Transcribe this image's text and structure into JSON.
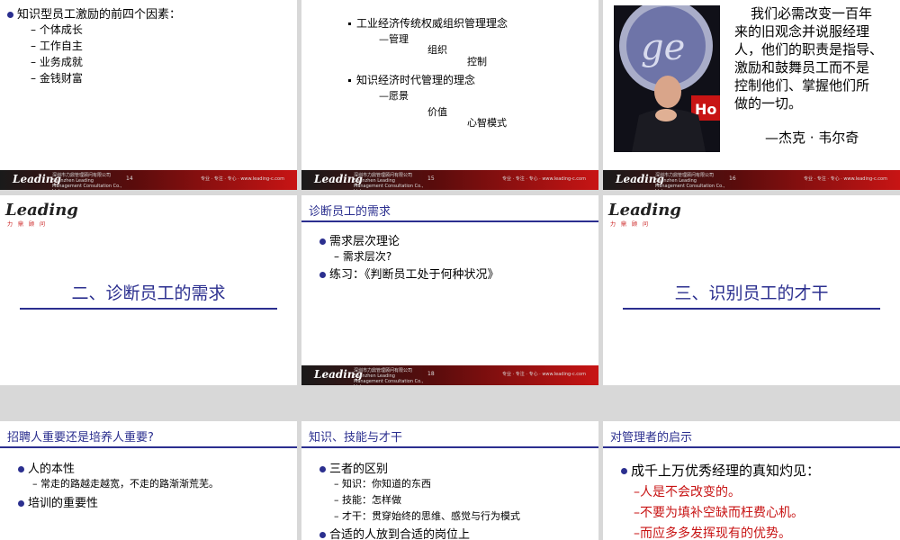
{
  "footer": {
    "logo": "Leading",
    "company": "深圳市力鼎管理顾问有限公司",
    "company_en": "Shenzhen Leading Management Consultation Co., Ltd.",
    "url": "专业 · 专注 · 专心 · www.leading-c.com"
  },
  "slide14": {
    "heading": "知识型员工激励的前四个因素：",
    "items": [
      "个体成长",
      "工作自主",
      "业务成就",
      "金钱财富"
    ],
    "page": "14"
  },
  "slide15": {
    "b1": "工业经济传统权威组织管理理念",
    "b1_sub": [
      "—管理",
      "组织",
      "控制"
    ],
    "b2": "知识经济时代管理的理念",
    "b2_sub": [
      "—愿景",
      "价值",
      "心智模式"
    ],
    "page": "15"
  },
  "slide16": {
    "quote": [
      "我们必需改变一百年",
      "来的旧观念并说服经理",
      "人，他们的职责是指导、",
      "激励和鼓舞员工而不是",
      "控制他们、掌握他们所",
      "做的一切。"
    ],
    "author": "—杰克 · 韦尔奇",
    "page": "16"
  },
  "slide17": {
    "logo": "Leading",
    "logo_sub": "力鼎顾问",
    "title": "二、诊断员工的需求"
  },
  "slide18": {
    "header": "诊断员工的需求",
    "b1": "需求层次理论",
    "b1_sub": "需求层次?",
    "b2": "练习：《判断员工处于何种状况》",
    "page": "18"
  },
  "slide19": {
    "logo": "Leading",
    "logo_sub": "力鼎顾问",
    "title": "三、识别员工的才干"
  },
  "slide20": {
    "header": "招聘人重要还是培养人重要?",
    "b1": "人的本性",
    "b1_sub": "常走的路越走越宽，不走的路渐渐荒芜。",
    "b2": "培训的重要性"
  },
  "slide21": {
    "header": "知识、技能与才干",
    "b1": "三者的区别",
    "subs": [
      "知识：你知道的东西",
      "技能：怎样做",
      "才干：贯穿始终的思维、感觉与行为模式"
    ],
    "b2": "合适的人放到合适的岗位上"
  },
  "slide22": {
    "header": "对管理者的启示",
    "b1": "成千上万优秀经理的真知灼见：",
    "red": [
      "–人是不会改变的。",
      "–不要为填补空缺而枉费心机。",
      "–而应多多发挥现有的优势。"
    ]
  },
  "colors": {
    "accent": "#2b2f8f",
    "red": "#c81414"
  }
}
